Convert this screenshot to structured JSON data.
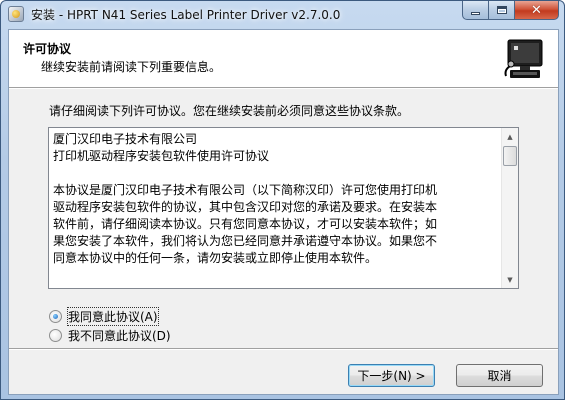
{
  "window": {
    "title": "安装 - HPRT N41 Series Label Printer Driver v2.7.0.0",
    "controls": {
      "minimize": "minimize-icon",
      "maximize": "maximize-icon",
      "close": "close-icon"
    }
  },
  "header": {
    "title": "许可协议",
    "subtitle": "继续安装前请阅读下列重要信息。",
    "image": "installer-computer-icon"
  },
  "intro": "请仔细阅读下列许可协议。您在继续安装前必须同意这些协议条款。",
  "license": {
    "lines": [
      "厦门汉印电子技术有限公司",
      "打印机驱动程序安装包软件使用许可协议",
      "",
      "本协议是厦门汉印电子技术有限公司（以下简称汉印）许可您使用打印机",
      "驱动程序安装包软件的协议，其中包含汉印对您的承诺及要求。在安装本",
      "软件前，请仔细阅读本协议。只有您同意本协议，才可以安装本软件；如",
      "果您安装了本软件，我们将认为您已经同意并承诺遵守本协议。如果您不",
      "同意本协议中的任何一条，请勿安装或立即停止使用本软件。"
    ],
    "scroll_position": 0
  },
  "options": {
    "accept": {
      "label": "我同意此协议(A)",
      "checked": true
    },
    "decline": {
      "label": "我不同意此协议(D)",
      "checked": false
    }
  },
  "buttons": {
    "next": "下一步(N) >",
    "cancel": "取消"
  },
  "colors": {
    "title_bar": "#b4cbe6",
    "close_button": "#c23a1e",
    "dialog_bg": "#f0f0f0",
    "default_button_border": "#3c7fb1"
  }
}
